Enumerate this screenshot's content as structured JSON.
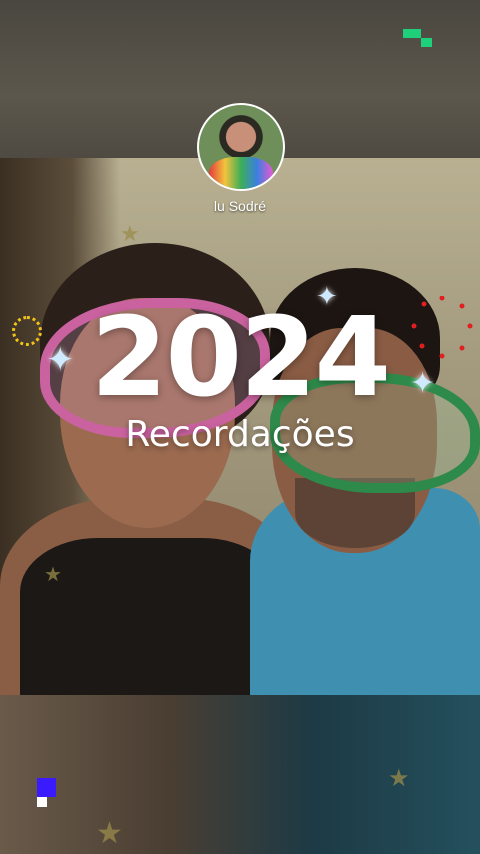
{
  "story": {
    "username": "lu Sodré",
    "year": "2024",
    "subtitle": "Recordações"
  },
  "colors": {
    "accent_green": "#1fd07a",
    "accent_blue": "#3a1aff",
    "sparkle": "#cfe9ff",
    "red_dots": "#e02020",
    "yellow": "#f2c41a"
  },
  "icons": {
    "avatar": "profile-avatar",
    "sparkles": "four-point-sparkle-icon",
    "stars": "star-icon",
    "sunburst": "sunburst-icon"
  }
}
